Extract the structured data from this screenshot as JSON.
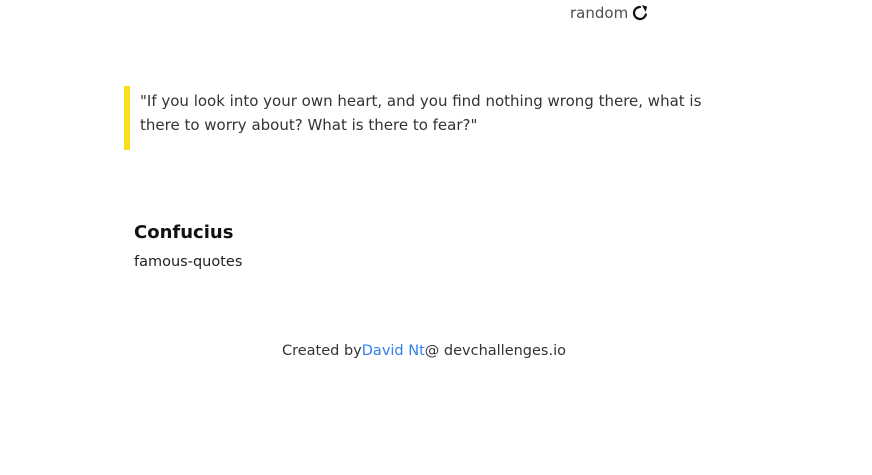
{
  "header": {
    "random_label": "random",
    "random_icon": "refresh-icon"
  },
  "quote": {
    "text": "\"If you look into your own heart, and you find nothing wrong there, what is there to worry about? What is there to fear?\"",
    "accent_color": "#f7df1e"
  },
  "author": {
    "name": "Confucius",
    "genre": "famous-quotes"
  },
  "footer": {
    "prefix": "Created by",
    "author_link": "David Nt",
    "suffix": "@ devchallenges.io",
    "link_color": "#2f80ed"
  }
}
